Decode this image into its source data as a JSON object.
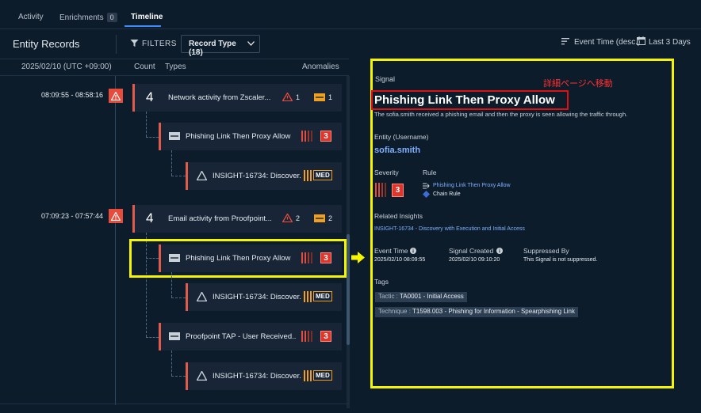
{
  "tabs": {
    "activity": "Activity",
    "enrichments": "Enrichments",
    "enrichments_count": "0",
    "timeline": "Timeline"
  },
  "header": {
    "title": "Entity Records",
    "filters_label": "FILTERS",
    "record_type_label": "Record Type",
    "record_type_count": "(18)",
    "sort_label": "Event Time (desc.)",
    "range_label": "Last 3 Days"
  },
  "columns": {
    "date": "2025/02/10 (UTC +09:00)",
    "count": "Count",
    "types": "Types",
    "anomalies": "Anomalies"
  },
  "groups": [
    {
      "time": "08:09:55 - 08:58:16",
      "count": "4",
      "title": "Network activity from Zscaler...",
      "alert_count": "1",
      "signal_count": "1"
    },
    {
      "time": "07:09:23 - 07:57:44",
      "count": "4",
      "title": "Email activity from Proofpoint...",
      "alert_count": "2",
      "signal_count": "2"
    }
  ],
  "signals": [
    {
      "title": "Phishing Link Then Proxy Allow",
      "severity": "3"
    },
    {
      "title": "Phishing Link Then Proxy Allow",
      "severity": "3"
    },
    {
      "title": "Proofpoint TAP - User Received...",
      "severity": "3"
    }
  ],
  "insights": [
    {
      "title": "INSIGHT-16734: Discover...",
      "level": "MED"
    },
    {
      "title": "INSIGHT-16734: Discover...",
      "level": "MED"
    },
    {
      "title": "INSIGHT-16734: Discover...",
      "level": "MED"
    }
  ],
  "annotation": "詳細ページへ移動",
  "detail": {
    "section": "Signal",
    "title": "Phishing Link Then Proxy Allow",
    "description": "The sofia.smith received a phishing email and then the proxy is seen allowing the traffic through.",
    "entity_label": "Entity (Username)",
    "entity_value": "sofia.smith",
    "severity_label": "Severity",
    "severity_value": "3",
    "rule_label": "Rule",
    "rule_name": "Phishing Link Then Proxy Allow",
    "rule_type": "Chain Rule",
    "related_label": "Related Insights",
    "related_value": "INSIGHT-16734 - Discovery with Execution and Initial Access",
    "event_time_label": "Event Time",
    "event_time_value": "2025/02/10 08:09:55",
    "signal_created_label": "Signal Created",
    "signal_created_value": "2025/02/10 09:10:20",
    "suppressed_label": "Suppressed By",
    "suppressed_value": "This Signal is not suppressed.",
    "tags_label": "Tags",
    "tags": [
      {
        "key": "Tactic :",
        "value": "TA0001 - Initial Access"
      },
      {
        "key": "Technique :",
        "value": "T1598.003 - Phishing for Information - Spearphishing Link"
      }
    ]
  },
  "colors": {
    "background": "#0d1c2b",
    "card": "#172536",
    "severity_red": "#e0352b",
    "medium_orange": "#f0a020",
    "link_blue": "#7fb0ff",
    "highlight_yellow": "#f5f500",
    "annotation_red": "#e01010"
  }
}
